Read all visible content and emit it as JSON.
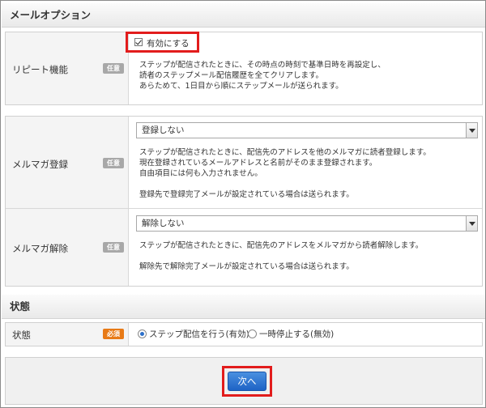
{
  "mail_option": {
    "section_title": "メールオプション",
    "repeat": {
      "label": "リピート機能",
      "badge": "任意",
      "checkbox_label": "有効にする",
      "checked": true,
      "desc": [
        "ステップが配信されたときに、その時点の時刻で基準日時を再設定し、",
        "読者のステップメール配信履歴を全てクリアします。",
        "あらためて、1日目から順にステップメールが送られます。"
      ]
    },
    "register": {
      "label": "メルマガ登録",
      "badge": "任意",
      "select_value": "登録しない",
      "desc": [
        "ステップが配信されたときに、配信先のアドレスを他のメルマガに読者登録します。",
        "現在登録されているメールアドレスと名前がそのまま登録されます。",
        "自由項目には何も入力されません。",
        "",
        "登録先で登録完了メールが設定されている場合は送られます。"
      ]
    },
    "unregister": {
      "label": "メルマガ解除",
      "badge": "任意",
      "select_value": "解除しない",
      "desc": [
        "ステップが配信されたときに、配信先のアドレスをメルマガから読者解除します。",
        "",
        "解除先で解除完了メールが設定されている場合は送られます。"
      ]
    }
  },
  "status": {
    "section_title": "状態",
    "label": "状態",
    "badge": "必須",
    "options": [
      {
        "label": "ステップ配信を行う(有効)",
        "selected": true
      },
      {
        "label": "一時停止する(無効)",
        "selected": false
      }
    ]
  },
  "footer": {
    "next_label": "次へ"
  },
  "colors": {
    "highlight": "#e21c1c",
    "button": "#1e63c5",
    "required_badge": "#e87a16",
    "optional_badge": "#a8a8a8"
  }
}
